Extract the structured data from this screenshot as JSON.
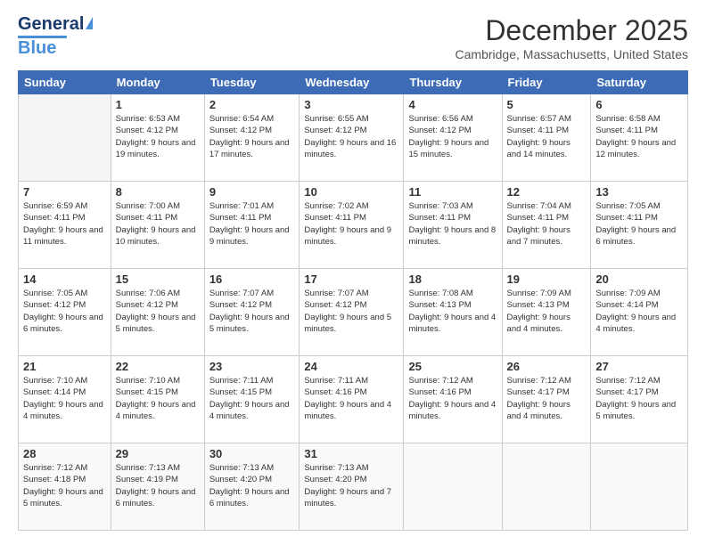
{
  "header": {
    "logo": {
      "general": "General",
      "blue": "Blue"
    },
    "title": "December 2025",
    "location": "Cambridge, Massachusetts, United States"
  },
  "weekdays": [
    "Sunday",
    "Monday",
    "Tuesday",
    "Wednesday",
    "Thursday",
    "Friday",
    "Saturday"
  ],
  "rows": [
    [
      {
        "day": "",
        "sunrise": "",
        "sunset": "",
        "daylight": ""
      },
      {
        "day": "1",
        "sunrise": "Sunrise: 6:53 AM",
        "sunset": "Sunset: 4:12 PM",
        "daylight": "Daylight: 9 hours and 19 minutes."
      },
      {
        "day": "2",
        "sunrise": "Sunrise: 6:54 AM",
        "sunset": "Sunset: 4:12 PM",
        "daylight": "Daylight: 9 hours and 17 minutes."
      },
      {
        "day": "3",
        "sunrise": "Sunrise: 6:55 AM",
        "sunset": "Sunset: 4:12 PM",
        "daylight": "Daylight: 9 hours and 16 minutes."
      },
      {
        "day": "4",
        "sunrise": "Sunrise: 6:56 AM",
        "sunset": "Sunset: 4:12 PM",
        "daylight": "Daylight: 9 hours and 15 minutes."
      },
      {
        "day": "5",
        "sunrise": "Sunrise: 6:57 AM",
        "sunset": "Sunset: 4:11 PM",
        "daylight": "Daylight: 9 hours and 14 minutes."
      },
      {
        "day": "6",
        "sunrise": "Sunrise: 6:58 AM",
        "sunset": "Sunset: 4:11 PM",
        "daylight": "Daylight: 9 hours and 12 minutes."
      }
    ],
    [
      {
        "day": "7",
        "sunrise": "Sunrise: 6:59 AM",
        "sunset": "Sunset: 4:11 PM",
        "daylight": "Daylight: 9 hours and 11 minutes."
      },
      {
        "day": "8",
        "sunrise": "Sunrise: 7:00 AM",
        "sunset": "Sunset: 4:11 PM",
        "daylight": "Daylight: 9 hours and 10 minutes."
      },
      {
        "day": "9",
        "sunrise": "Sunrise: 7:01 AM",
        "sunset": "Sunset: 4:11 PM",
        "daylight": "Daylight: 9 hours and 9 minutes."
      },
      {
        "day": "10",
        "sunrise": "Sunrise: 7:02 AM",
        "sunset": "Sunset: 4:11 PM",
        "daylight": "Daylight: 9 hours and 9 minutes."
      },
      {
        "day": "11",
        "sunrise": "Sunrise: 7:03 AM",
        "sunset": "Sunset: 4:11 PM",
        "daylight": "Daylight: 9 hours and 8 minutes."
      },
      {
        "day": "12",
        "sunrise": "Sunrise: 7:04 AM",
        "sunset": "Sunset: 4:11 PM",
        "daylight": "Daylight: 9 hours and 7 minutes."
      },
      {
        "day": "13",
        "sunrise": "Sunrise: 7:05 AM",
        "sunset": "Sunset: 4:11 PM",
        "daylight": "Daylight: 9 hours and 6 minutes."
      }
    ],
    [
      {
        "day": "14",
        "sunrise": "Sunrise: 7:05 AM",
        "sunset": "Sunset: 4:12 PM",
        "daylight": "Daylight: 9 hours and 6 minutes."
      },
      {
        "day": "15",
        "sunrise": "Sunrise: 7:06 AM",
        "sunset": "Sunset: 4:12 PM",
        "daylight": "Daylight: 9 hours and 5 minutes."
      },
      {
        "day": "16",
        "sunrise": "Sunrise: 7:07 AM",
        "sunset": "Sunset: 4:12 PM",
        "daylight": "Daylight: 9 hours and 5 minutes."
      },
      {
        "day": "17",
        "sunrise": "Sunrise: 7:07 AM",
        "sunset": "Sunset: 4:12 PM",
        "daylight": "Daylight: 9 hours and 5 minutes."
      },
      {
        "day": "18",
        "sunrise": "Sunrise: 7:08 AM",
        "sunset": "Sunset: 4:13 PM",
        "daylight": "Daylight: 9 hours and 4 minutes."
      },
      {
        "day": "19",
        "sunrise": "Sunrise: 7:09 AM",
        "sunset": "Sunset: 4:13 PM",
        "daylight": "Daylight: 9 hours and 4 minutes."
      },
      {
        "day": "20",
        "sunrise": "Sunrise: 7:09 AM",
        "sunset": "Sunset: 4:14 PM",
        "daylight": "Daylight: 9 hours and 4 minutes."
      }
    ],
    [
      {
        "day": "21",
        "sunrise": "Sunrise: 7:10 AM",
        "sunset": "Sunset: 4:14 PM",
        "daylight": "Daylight: 9 hours and 4 minutes."
      },
      {
        "day": "22",
        "sunrise": "Sunrise: 7:10 AM",
        "sunset": "Sunset: 4:15 PM",
        "daylight": "Daylight: 9 hours and 4 minutes."
      },
      {
        "day": "23",
        "sunrise": "Sunrise: 7:11 AM",
        "sunset": "Sunset: 4:15 PM",
        "daylight": "Daylight: 9 hours and 4 minutes."
      },
      {
        "day": "24",
        "sunrise": "Sunrise: 7:11 AM",
        "sunset": "Sunset: 4:16 PM",
        "daylight": "Daylight: 9 hours and 4 minutes."
      },
      {
        "day": "25",
        "sunrise": "Sunrise: 7:12 AM",
        "sunset": "Sunset: 4:16 PM",
        "daylight": "Daylight: 9 hours and 4 minutes."
      },
      {
        "day": "26",
        "sunrise": "Sunrise: 7:12 AM",
        "sunset": "Sunset: 4:17 PM",
        "daylight": "Daylight: 9 hours and 4 minutes."
      },
      {
        "day": "27",
        "sunrise": "Sunrise: 7:12 AM",
        "sunset": "Sunset: 4:17 PM",
        "daylight": "Daylight: 9 hours and 5 minutes."
      }
    ],
    [
      {
        "day": "28",
        "sunrise": "Sunrise: 7:12 AM",
        "sunset": "Sunset: 4:18 PM",
        "daylight": "Daylight: 9 hours and 5 minutes."
      },
      {
        "day": "29",
        "sunrise": "Sunrise: 7:13 AM",
        "sunset": "Sunset: 4:19 PM",
        "daylight": "Daylight: 9 hours and 6 minutes."
      },
      {
        "day": "30",
        "sunrise": "Sunrise: 7:13 AM",
        "sunset": "Sunset: 4:20 PM",
        "daylight": "Daylight: 9 hours and 6 minutes."
      },
      {
        "day": "31",
        "sunrise": "Sunrise: 7:13 AM",
        "sunset": "Sunset: 4:20 PM",
        "daylight": "Daylight: 9 hours and 7 minutes."
      },
      {
        "day": "",
        "sunrise": "",
        "sunset": "",
        "daylight": ""
      },
      {
        "day": "",
        "sunrise": "",
        "sunset": "",
        "daylight": ""
      },
      {
        "day": "",
        "sunrise": "",
        "sunset": "",
        "daylight": ""
      }
    ]
  ]
}
